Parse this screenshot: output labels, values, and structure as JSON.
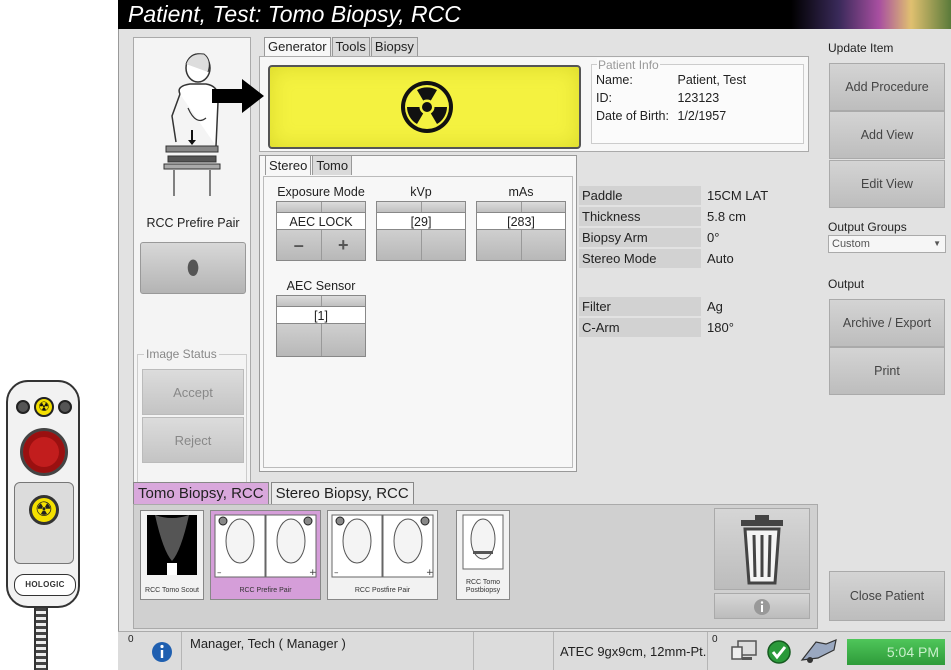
{
  "title": {
    "patient": "Patient, Test:",
    "procedure": "Tomo Biopsy, RCC"
  },
  "remote": {
    "logo": "HOLOGIC"
  },
  "left": {
    "view_label": "RCC Prefire Pair",
    "image_status_label": "Image Status",
    "accept_label": "Accept",
    "reject_label": "Reject"
  },
  "tabs": [
    "Generator",
    "Tools",
    "Biopsy"
  ],
  "patient_info": {
    "label": "Patient Info",
    "name_key": "Name:",
    "name_value": "Patient, Test",
    "id_key": "ID:",
    "id_value": "123123",
    "dob_key": "Date of Birth:",
    "dob_value": "1/2/1957"
  },
  "sub_tabs": [
    "Stereo",
    "Tomo"
  ],
  "controls": {
    "exposure_mode_label": "Exposure Mode",
    "exposure_mode_value": "AEC LOCK",
    "kvp_label": "kVp",
    "kvp_value": "[29]",
    "mas_label": "mAs",
    "mas_value": "[283]",
    "aec_sensor_label": "AEC Sensor",
    "aec_sensor_value": "[1]",
    "minus": "–",
    "plus": "+"
  },
  "params": [
    {
      "key": "Paddle",
      "value": "15CM LAT"
    },
    {
      "key": "Thickness",
      "value": "5.8 cm"
    },
    {
      "key": "Biopsy Arm",
      "value": "0°"
    },
    {
      "key": "Stereo Mode",
      "value": "Auto"
    },
    {
      "key": "Filter",
      "value": "Ag"
    },
    {
      "key": "C-Arm",
      "value": "180°"
    }
  ],
  "right": {
    "update_item_label": "Update Item",
    "add_procedure": "Add Procedure",
    "add_view": "Add View",
    "edit_view": "Edit View",
    "output_groups_label": "Output Groups",
    "output_groups_value": "Custom",
    "output_label": "Output",
    "archive_export": "Archive / Export",
    "print": "Print",
    "close_patient": "Close Patient"
  },
  "procedure_tabs": [
    "Tomo Biopsy, RCC",
    "Stereo Biopsy, RCC"
  ],
  "thumbnails": [
    {
      "caption": "RCC Tomo Scout"
    },
    {
      "caption": "RCC Prefire Pair"
    },
    {
      "caption": "RCC Postfire Pair"
    },
    {
      "caption": "RCC Tomo Postbiopsy"
    }
  ],
  "status": {
    "count_left": "0",
    "user": "Manager, Tech ( Manager )",
    "device": "ATEC 9gx9cm, 12mm-Pt.",
    "count_right": "0",
    "clock": "5:04 PM"
  },
  "colors": {
    "xray_yellow": "#f4f240",
    "selected_tab": "#d9a8dc",
    "clock_green": "#2e9b3a"
  }
}
